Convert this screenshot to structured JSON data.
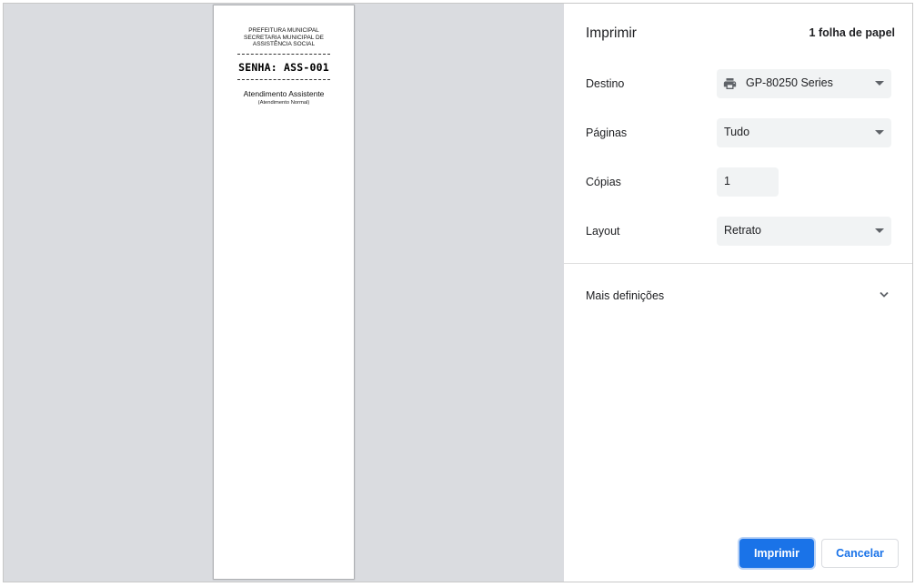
{
  "preview": {
    "header_lines": [
      "PREFEITURA MUNICIPAL",
      "SECRETARIA MUNICIPAL DE",
      "ASSISTÊNCIA SOCIAL"
    ],
    "ticket": "SENHA: ASS-001",
    "service": "Atendimento Assistente",
    "service_type": "(Atendimento Normal)"
  },
  "panel": {
    "title": "Imprimir",
    "sheet_count": "1 folha de papel",
    "destination": {
      "label": "Destino",
      "value": "GP-80250 Series",
      "icon": "printer-icon"
    },
    "pages": {
      "label": "Páginas",
      "value": "Tudo"
    },
    "copies": {
      "label": "Cópias",
      "value": "1"
    },
    "layout": {
      "label": "Layout",
      "value": "Retrato"
    },
    "more_settings": "Mais definições",
    "print_button": "Imprimir",
    "cancel_button": "Cancelar"
  },
  "colors": {
    "accent": "#1a73e8",
    "preview_background": "#dadce0",
    "field_background": "#f1f3f4"
  }
}
